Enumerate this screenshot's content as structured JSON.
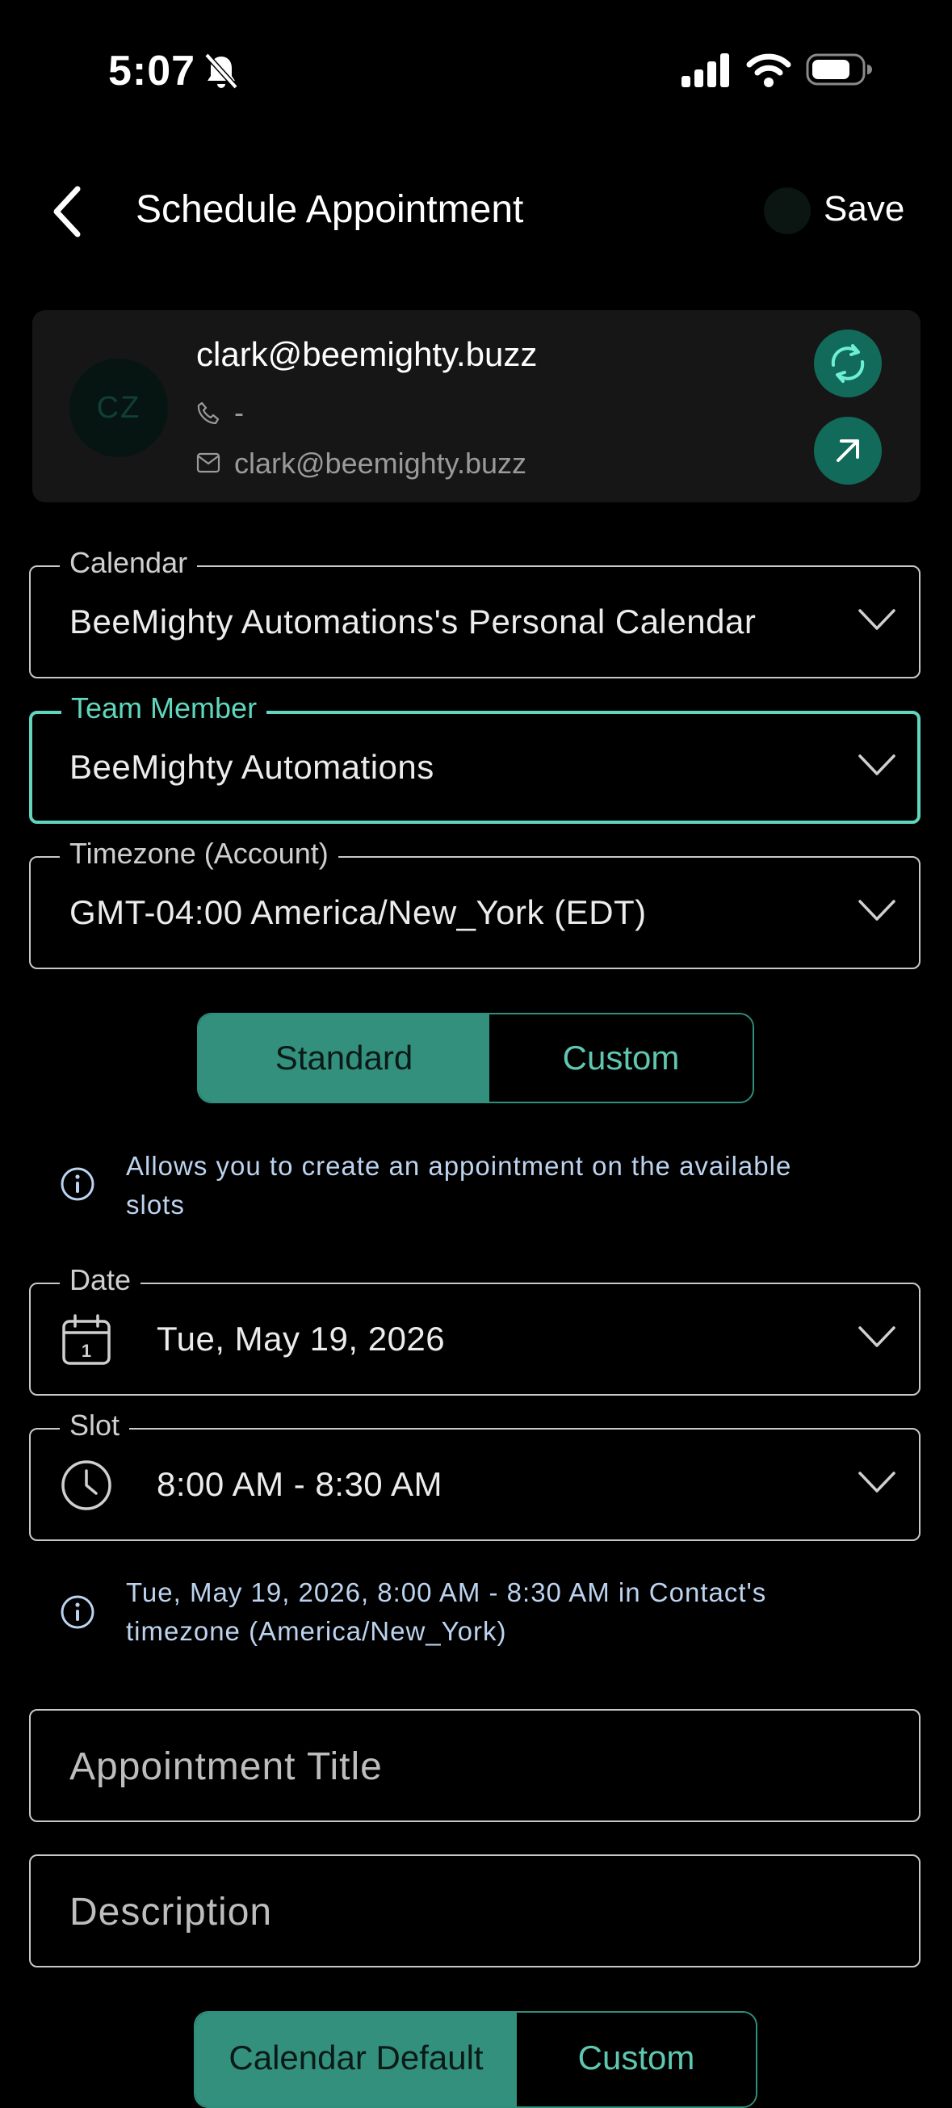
{
  "status_bar": {
    "time": "5:07"
  },
  "header": {
    "title": "Schedule Appointment",
    "save_label": "Save"
  },
  "contact": {
    "initials": "CZ",
    "name": "clark@beemighty.buzz",
    "phone": "-",
    "email": "clark@beemighty.buzz"
  },
  "fields": {
    "calendar": {
      "label": "Calendar",
      "value": "BeeMighty Automations's Personal Calendar"
    },
    "team_member": {
      "label": "Team Member",
      "value": "BeeMighty Automations"
    },
    "timezone": {
      "label": "Timezone (Account)",
      "value": "GMT-04:00 America/New_York (EDT)"
    },
    "date": {
      "label": "Date",
      "value": "Tue, May 19, 2026",
      "icon_day": "1"
    },
    "slot": {
      "label": "Slot",
      "value": "8:00 AM - 8:30 AM"
    },
    "title": {
      "placeholder": "Appointment Title"
    },
    "description": {
      "placeholder": "Description"
    }
  },
  "mode_toggle": {
    "options": [
      "Standard",
      "Custom"
    ],
    "selected": "Standard"
  },
  "info": {
    "mode_line1": "Allows you to create an appointment on the available",
    "mode_line2": "slots",
    "slot_line1": "Tue, May 19, 2026, 8:00 AM - 8:30 AM in Contact's",
    "slot_line2": "timezone (America/New_York)"
  },
  "location_toggle": {
    "options": [
      "Calendar Default",
      "Custom"
    ],
    "selected": "Calendar Default"
  },
  "colors": {
    "accent": "#5fd6bd",
    "accent_dark": "#33907d",
    "button_bg": "#126b5a",
    "info_text": "#bcd3ef"
  }
}
